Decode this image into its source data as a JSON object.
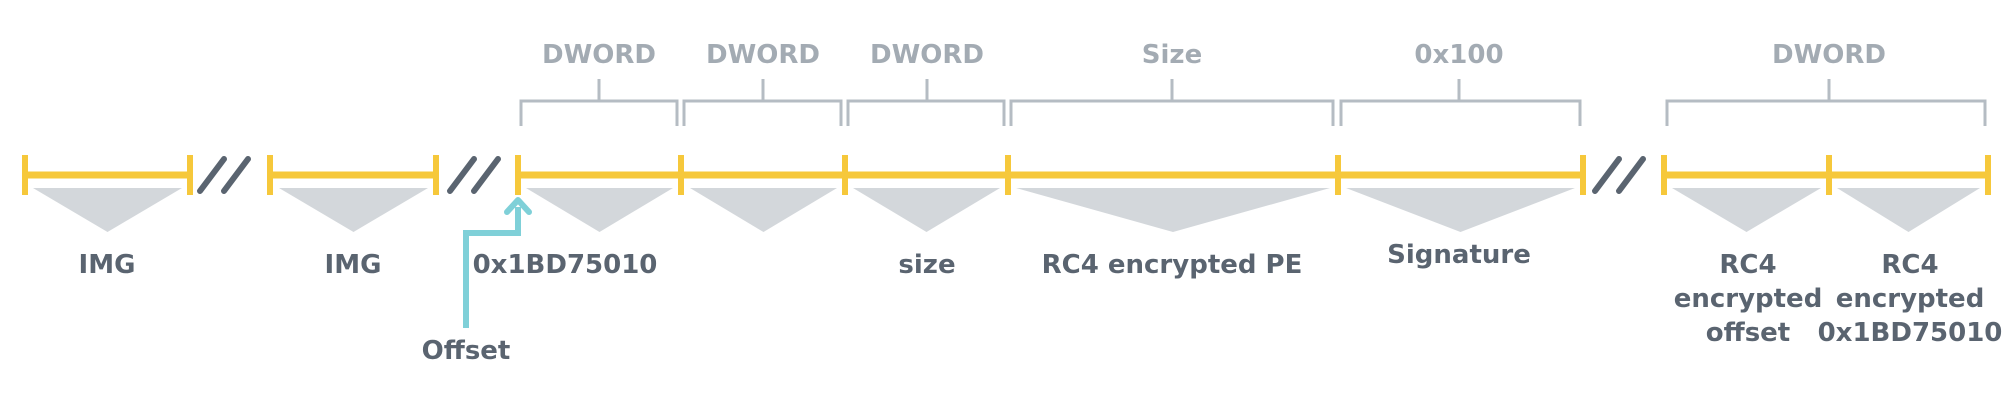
{
  "colors": {
    "track": "#f6c83b",
    "bracket": "#b5bcc3",
    "wedge": "#d3d7db",
    "text": "#5a6470",
    "header_text": "#a3abb3",
    "arrow": "#7fd0d8",
    "break_marks": "#5a6470"
  },
  "headers": [
    {
      "id": "h1",
      "text": "DWORD"
    },
    {
      "id": "h2",
      "text": "DWORD"
    },
    {
      "id": "h3",
      "text": "DWORD"
    },
    {
      "id": "h4",
      "text": "Size"
    },
    {
      "id": "h5",
      "text": "0x100"
    },
    {
      "id": "h6",
      "text": "DWORD"
    }
  ],
  "segments": [
    {
      "id": "s1",
      "label": "IMG"
    },
    {
      "id": "s2",
      "label": "IMG"
    },
    {
      "id": "s3",
      "label": "0x1BD75010"
    },
    {
      "id": "s4",
      "label": ""
    },
    {
      "id": "s5",
      "label": "size"
    },
    {
      "id": "s6",
      "label": "RC4 encrypted PE"
    },
    {
      "id": "s7",
      "label": "Signature"
    },
    {
      "id": "s8",
      "label": "RC4\nencrypted\noffset"
    },
    {
      "id": "s9",
      "label": "RC4\nencrypted\n0x1BD75010"
    }
  ],
  "pointer": {
    "label": "Offset",
    "icon": "arrow-up-icon"
  }
}
